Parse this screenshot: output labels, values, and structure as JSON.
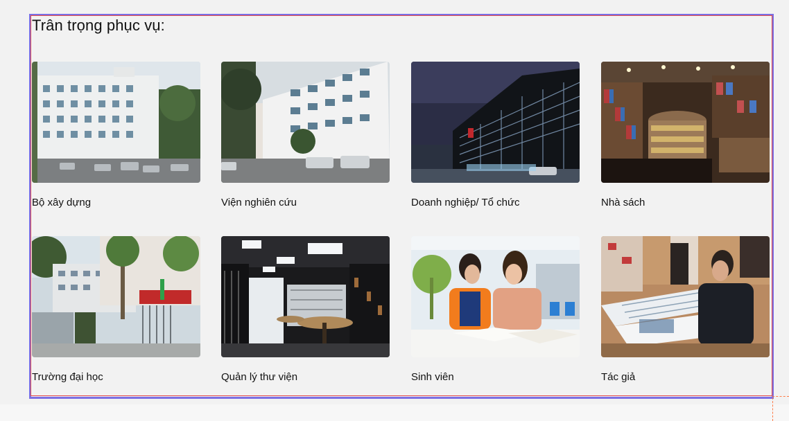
{
  "section": {
    "title": "Trân trọng phục vụ:"
  },
  "cards": [
    {
      "label": "Bộ xây dựng",
      "image": "office-building-photo"
    },
    {
      "label": "Viện nghiên cứu",
      "image": "research-institute-photo"
    },
    {
      "label": "Doanh nghiệp/ Tổ chức",
      "image": "corporate-tower-photo"
    },
    {
      "label": "Nhà sách",
      "image": "bookstore-photo"
    },
    {
      "label": "Trường đại học",
      "image": "university-gate-photo"
    },
    {
      "label": "Quản lý thư viện",
      "image": "library-interior-photo"
    },
    {
      "label": "Sinh viên",
      "image": "students-reading-photo"
    },
    {
      "label": "Tác giả",
      "image": "author-reading-photo"
    }
  ]
}
